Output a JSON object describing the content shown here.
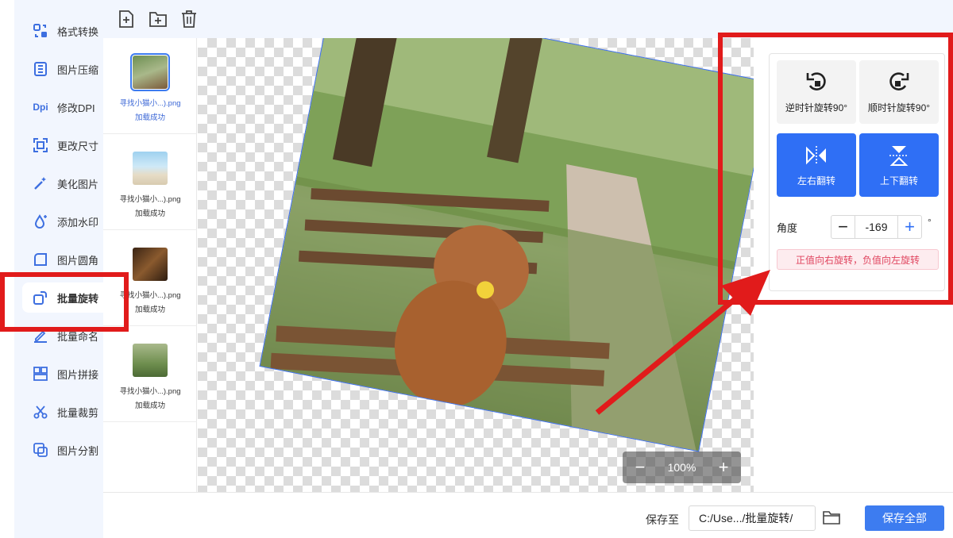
{
  "sidebar": {
    "items": [
      {
        "label": "格式转换",
        "icon": "format-convert-icon"
      },
      {
        "label": "图片压缩",
        "icon": "compress-icon"
      },
      {
        "label": "修改DPI",
        "icon": "dpi-icon",
        "icon_text": "Dpi"
      },
      {
        "label": "更改尺寸",
        "icon": "resize-icon"
      },
      {
        "label": "美化图片",
        "icon": "beautify-icon"
      },
      {
        "label": "添加水印",
        "icon": "watermark-icon"
      },
      {
        "label": "图片圆角",
        "icon": "round-corner-icon"
      },
      {
        "label": "批量旋转",
        "icon": "rotate-icon",
        "active": true
      },
      {
        "label": "批量命名",
        "icon": "rename-icon"
      },
      {
        "label": "图片拼接",
        "icon": "collage-icon"
      },
      {
        "label": "批量裁剪",
        "icon": "crop-icon"
      },
      {
        "label": "图片分割",
        "icon": "split-icon"
      }
    ]
  },
  "toolbar": {
    "icons": [
      "add-file-icon",
      "add-folder-icon",
      "trash-icon"
    ]
  },
  "thumbnails": [
    {
      "name": "寻找小猫小...).png",
      "status": "加载成功",
      "selected": true
    },
    {
      "name": "寻找小猫小...).png",
      "status": "加载成功"
    },
    {
      "name": "寻找小猫小...).png",
      "status": "加载成功"
    },
    {
      "name": "寻找小猫小...).png",
      "status": "加载成功"
    }
  ],
  "preview": {
    "zoom": "100%",
    "rotation_degrees": -169
  },
  "rotate_panel": {
    "ccw_label": "逆时针旋转90°",
    "cw_label": "顺时针旋转90°",
    "flip_h_label": "左右翻转",
    "flip_v_label": "上下翻转",
    "angle_label": "角度",
    "angle_value": "-169",
    "degree_symbol": "°",
    "hint": "正值向右旋转，负值向左旋转"
  },
  "footer": {
    "save_to_label": "保存至",
    "path": "C:/Use.../批量旋转/",
    "save_all_label": "保存全部"
  },
  "colors": {
    "accent": "#2f6ff5",
    "annotation_red": "#e11b1b",
    "sidebar_bg": "#f2f6fe"
  }
}
